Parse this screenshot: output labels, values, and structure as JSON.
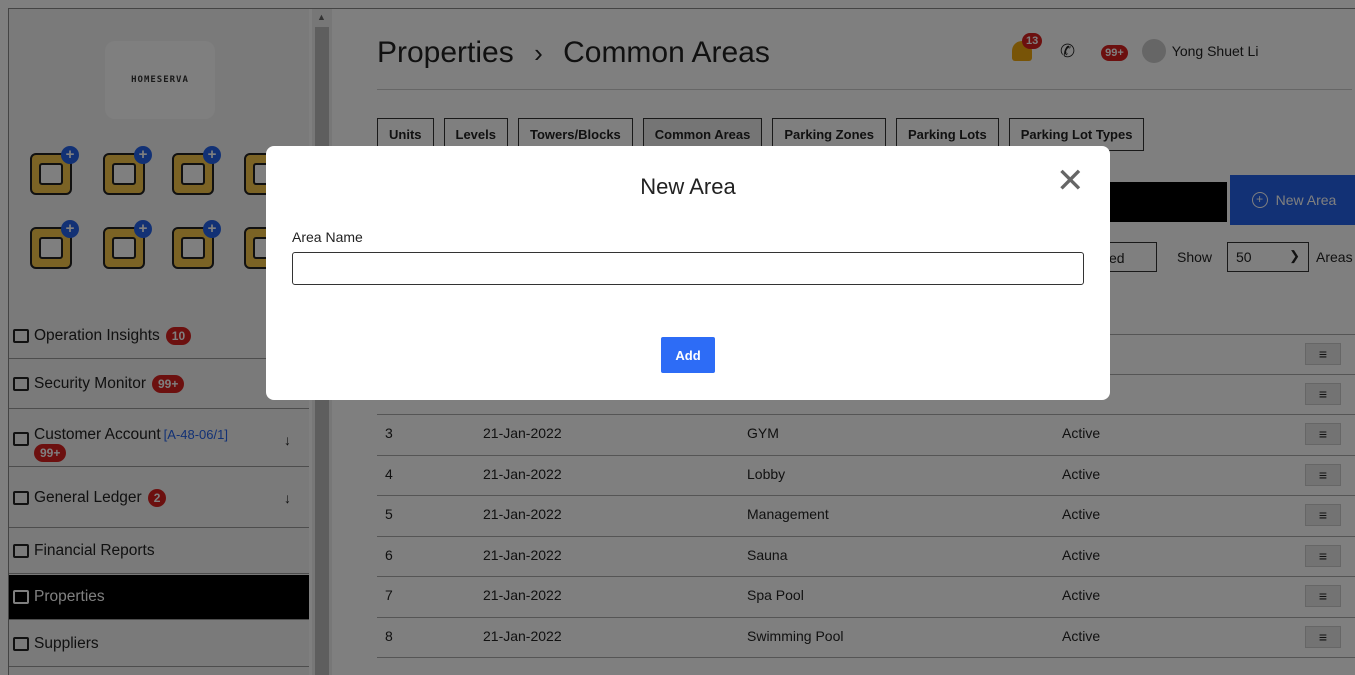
{
  "brand": {
    "logo_text": "HOMESERVA"
  },
  "sidebar": {
    "items": [
      {
        "label": "Operation Insights",
        "badge": "10",
        "icon": "bar-chart-icon"
      },
      {
        "label": "Security Monitor",
        "badge": "99+",
        "icon": "monitor-icon"
      },
      {
        "label": "Customer Account",
        "code": "[A-48-06/1]",
        "badge": "99+",
        "arrow": "↓",
        "icon": "account-card-icon"
      },
      {
        "label": "General Ledger",
        "badge": "2",
        "arrow": "↓",
        "icon": "ledger-icon"
      },
      {
        "label": "Financial Reports",
        "icon": "report-icon"
      },
      {
        "label": "Properties",
        "icon": "home-icon",
        "active": true
      },
      {
        "label": "Suppliers",
        "icon": "supplier-icon"
      }
    ]
  },
  "header": {
    "title": "Properties",
    "separator": "›",
    "subtitle": "Common Areas",
    "notif_count": "13",
    "msg_count": "99+",
    "user_name": "Yong Shuet Li"
  },
  "tabs": [
    "Units",
    "Levels",
    "Towers/Blocks",
    "Common Areas",
    "Parking Zones",
    "Parking Lots",
    "Parking Lot Types"
  ],
  "toolbar": {
    "new_area_label": "New Area",
    "filter_partial": "ed",
    "show_label": "Show",
    "show_value": "50",
    "areas_label": "Areas"
  },
  "table": {
    "rows": [
      {
        "no": "",
        "date": "",
        "name": "",
        "status": ""
      },
      {
        "no": "",
        "date": "",
        "name": "",
        "status": ""
      },
      {
        "no": "3",
        "date": "21-Jan-2022",
        "name": "GYM",
        "status": "Active"
      },
      {
        "no": "4",
        "date": "21-Jan-2022",
        "name": "Lobby",
        "status": "Active"
      },
      {
        "no": "5",
        "date": "21-Jan-2022",
        "name": "Management",
        "status": "Active"
      },
      {
        "no": "6",
        "date": "21-Jan-2022",
        "name": "Sauna",
        "status": "Active"
      },
      {
        "no": "7",
        "date": "21-Jan-2022",
        "name": "Spa Pool",
        "status": "Active"
      },
      {
        "no": "8",
        "date": "21-Jan-2022",
        "name": "Swimming Pool",
        "status": "Active"
      }
    ],
    "menu_glyph": "≡"
  },
  "modal": {
    "title": "New Area",
    "field_label": "Area Name",
    "field_value": "",
    "add_label": "Add",
    "close_glyph": "✕"
  },
  "colors": {
    "accent": "#2563eb",
    "badge": "#d9201e",
    "active_nav": "#000000"
  }
}
